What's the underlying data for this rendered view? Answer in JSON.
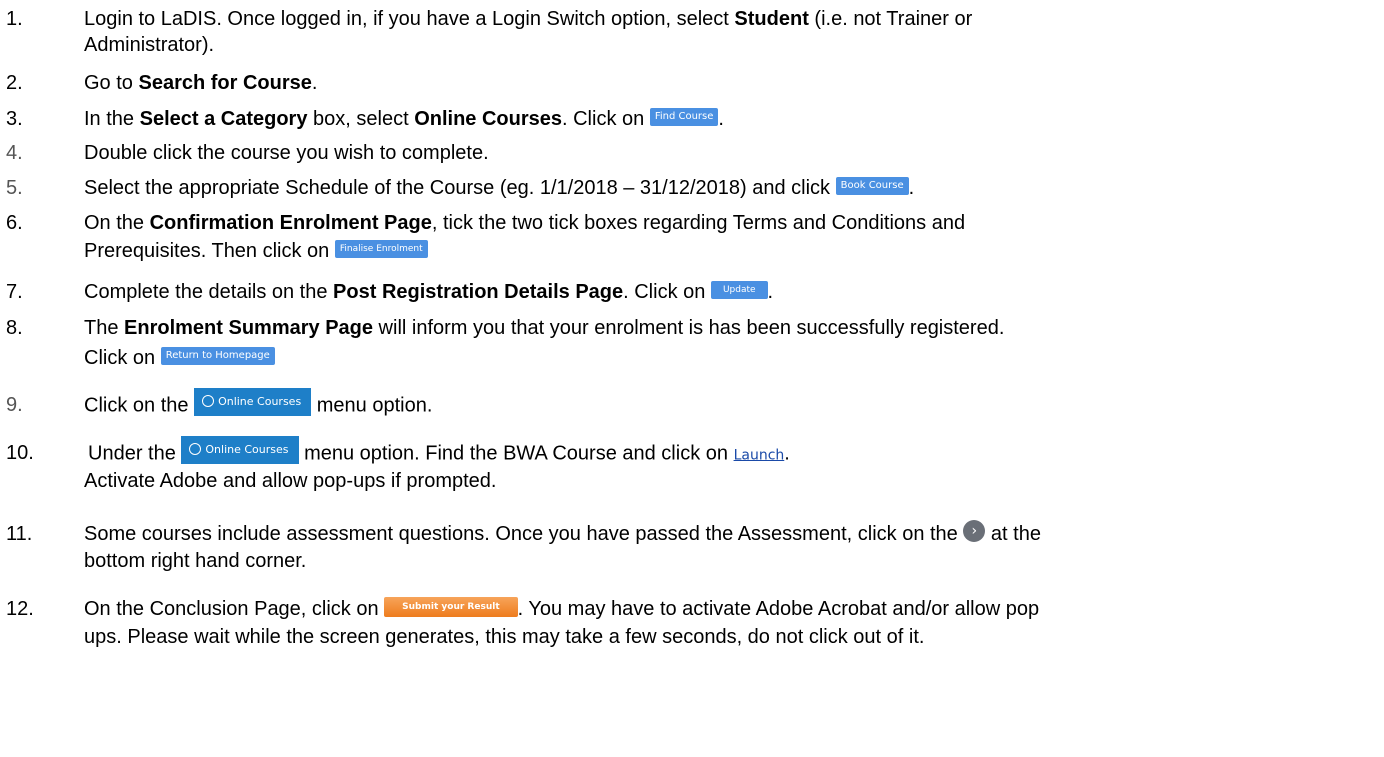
{
  "steps": [
    {
      "num": "1.",
      "t1": "Login to LaDIS. Once logged in, if you have a Login Switch option, select ",
      "b1": "Student",
      "t2": " (i.e. not Trainer or",
      "l2": "Administrator)."
    },
    {
      "num": "2.",
      "t1": "Go to ",
      "b1": "Search for Course",
      "t2": "."
    },
    {
      "num": "3.",
      "t1": "In the ",
      "b1": "Select a Category",
      "t2": " box, select ",
      "b2": "Online Courses",
      "t3": ". Click on ",
      "btn": "Find Course",
      "t4": "."
    },
    {
      "num": "4.",
      "t1": "Double click the course you wish to complete."
    },
    {
      "num": "5.",
      "t1": "Select the appropriate Schedule of the Course (eg. 1/1/2018 – 31/12/2018) and click ",
      "btn": "Book Course",
      "t2": "."
    },
    {
      "num": "6.",
      "t1": "On the ",
      "b1": "Confirmation Enrolment Page",
      "t2": ", tick the two tick boxes regarding Terms and Conditions and",
      "l2": "Prerequisites. Then click on ",
      "btn": "Finalise Enrolment"
    },
    {
      "num": "7.",
      "t1": "Complete the details on the ",
      "b1": "Post Registration Details Page",
      "t2": ". Click on ",
      "btn": "Update",
      "t3": "."
    },
    {
      "num": "8.",
      "t1": "The ",
      "b1": "Enrolment Summary Page",
      "t2": " will inform you that your enrolment is has been successfully registered.",
      "l2": "Click on ",
      "btn": "Return to Homepage"
    },
    {
      "num": "9.",
      "t1": "Click on the ",
      "menu": "Online Courses",
      "t2": " menu option."
    },
    {
      "num": "10.",
      "t1": "Under the ",
      "menu": "Online Courses",
      "t2": " menu option. Find the BWA Course and click on ",
      "link": "Launch",
      "t3": ".",
      "l2": "Activate Adobe and allow pop-ups if prompted."
    },
    {
      "num": "11.",
      "t1": "Some courses include assessment questions.  Once you have passed the Assessment, click on the ",
      "t2": " at the",
      "l2": "bottom right hand corner."
    },
    {
      "num": "12.",
      "t1": "On the Conclusion Page, click on ",
      "btn": "Submit your Result",
      "t2": ". You may have to activate Adobe Acrobat and/or allow pop",
      "l2": "ups. Please wait while the screen generates, this may take a few seconds, do not click out of it."
    }
  ]
}
